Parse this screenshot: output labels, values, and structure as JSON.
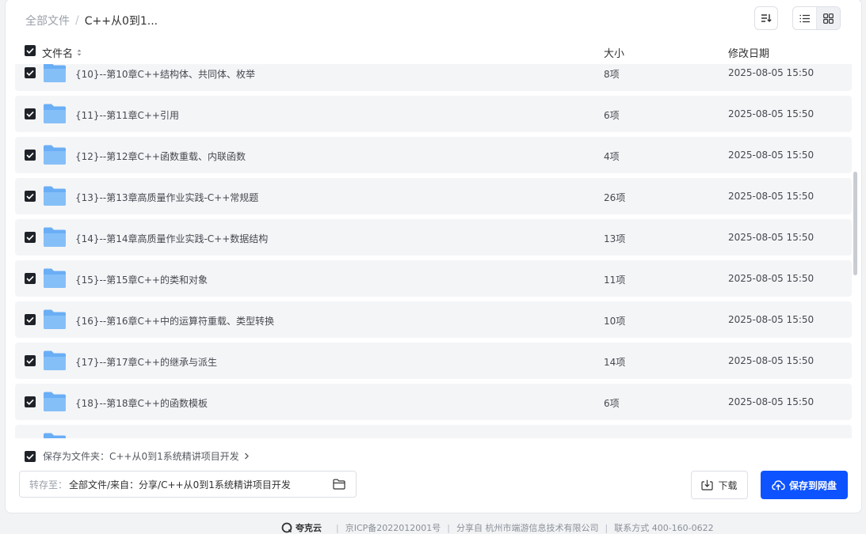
{
  "breadcrumb": {
    "root": "全部文件",
    "separator": "/",
    "current": "C++从0到1..."
  },
  "header": {
    "name": "文件名",
    "size": "大小",
    "date": "修改日期"
  },
  "colors": {
    "accent": "#0d53ff",
    "folder": "#6aaef5",
    "checkbox": "#1f2329"
  },
  "rows": [
    {
      "name": "{10}--第10章C++结构体、共同体、枚举",
      "size": "8项",
      "date": "2025-08-05 15:50"
    },
    {
      "name": "{11}--第11章C++引用",
      "size": "6项",
      "date": "2025-08-05 15:50"
    },
    {
      "name": "{12}--第12章C++函数重载、内联函数",
      "size": "4项",
      "date": "2025-08-05 15:50"
    },
    {
      "name": "{13}--第13章高质量作业实践-C++常规题",
      "size": "26项",
      "date": "2025-08-05 15:50"
    },
    {
      "name": "{14}--第14章高质量作业实践-C++数据结构",
      "size": "13项",
      "date": "2025-08-05 15:50"
    },
    {
      "name": "{15}--第15章C++的类和对象",
      "size": "11项",
      "date": "2025-08-05 15:50"
    },
    {
      "name": "{16}--第16章C++中的运算符重载、类型转换",
      "size": "10项",
      "date": "2025-08-05 15:50"
    },
    {
      "name": "{17}--第17章C++的继承与派生",
      "size": "14项",
      "date": "2025-08-05 15:50"
    },
    {
      "name": "{18}--第18章C++的函数模板",
      "size": "6项",
      "date": "2025-08-05 15:50"
    },
    {
      "name": "",
      "size": "",
      "date": ""
    }
  ],
  "bottom": {
    "save_as_folder": "保存为文件夹：C++从0到1系统精讲项目开发",
    "path_label": "转存至：",
    "path_value": "全部文件/来自：分享/C++从0到1系统精讲项目开发",
    "download": "下载",
    "save": "保存到网盘"
  },
  "footer": {
    "brand": "夸克云",
    "icp": "京ICP备2022012001号",
    "company": "分享自 杭州市端游信息技术有限公司",
    "contact": "联系方式 400-160-0622"
  }
}
